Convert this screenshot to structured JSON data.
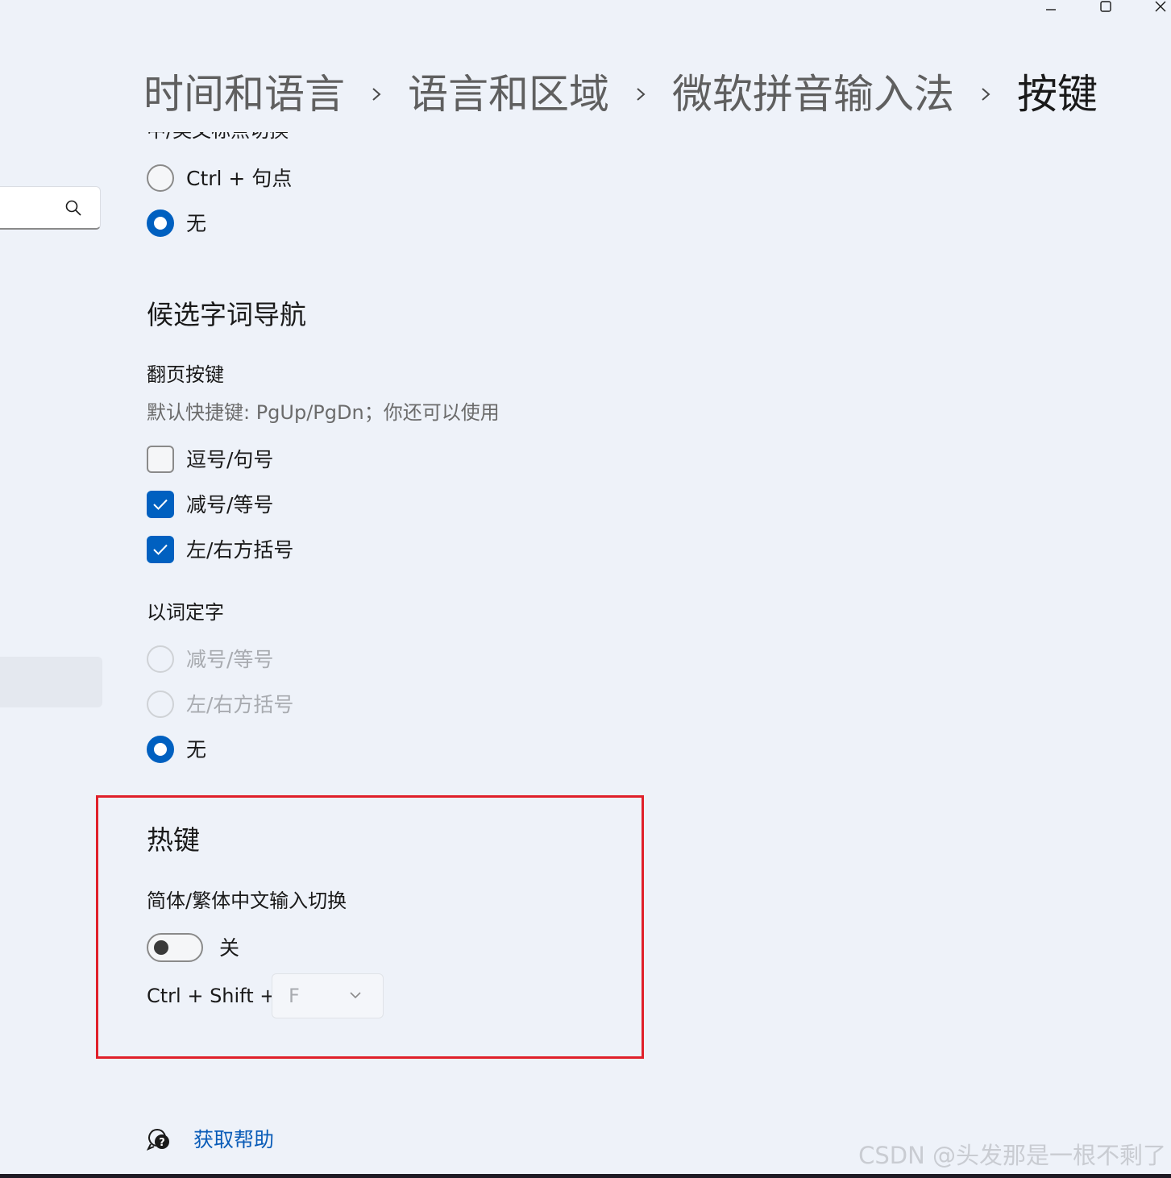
{
  "breadcrumb": {
    "items": [
      "时间和语言",
      "语言和区域",
      "微软拼音输入法",
      "按键"
    ],
    "separator_icon": "chevron-right-icon"
  },
  "punctuation_toggle": {
    "cut_label": "中/英文标点切换",
    "options": [
      {
        "label": "Ctrl + 句点",
        "checked": false
      },
      {
        "label": "无",
        "checked": true
      }
    ]
  },
  "candidate_navigation": {
    "title": "候选字词导航",
    "paging": {
      "title": "翻页按键",
      "description": "默认快捷键: PgUp/PgDn；你还可以使用",
      "options": [
        {
          "label": "逗号/句号",
          "checked": false
        },
        {
          "label": "减号/等号",
          "checked": true
        },
        {
          "label": "左/右方括号",
          "checked": true
        }
      ]
    },
    "word_to_char": {
      "title": "以词定字",
      "options": [
        {
          "label": "减号/等号",
          "checked": false,
          "disabled": true
        },
        {
          "label": "左/右方括号",
          "checked": false,
          "disabled": true
        },
        {
          "label": "无",
          "checked": true,
          "disabled": false
        }
      ]
    }
  },
  "hotkeys": {
    "title": "热键",
    "switch": {
      "title": "简体/繁体中文输入切换",
      "state": "关",
      "on": false
    },
    "shortcut": {
      "prefix": "Ctrl + Shift +",
      "key": "F"
    }
  },
  "help": {
    "label": "获取帮助"
  },
  "watermark": "CSDN @头发那是一根不剩了",
  "colors": {
    "accent": "#0060c0",
    "highlight_border": "#e0202a",
    "link": "#0a5cb8",
    "background": "#eef2f9"
  }
}
